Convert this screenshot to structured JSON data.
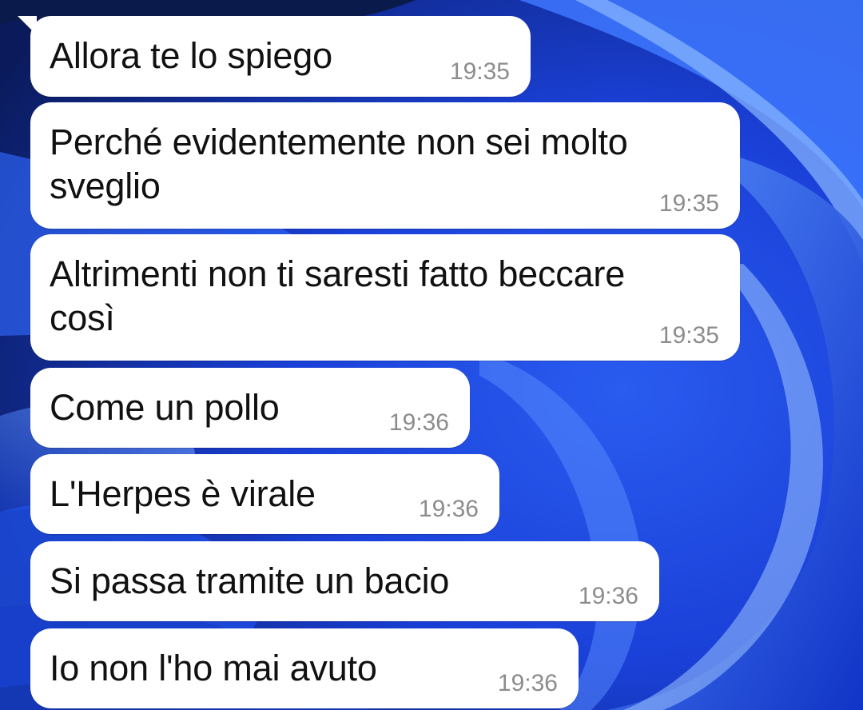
{
  "chat": {
    "messages": [
      {
        "text": "Allora te lo spiego",
        "time": "19:35"
      },
      {
        "text": "Perché evidentemente non sei molto\nsveglio",
        "time": "19:35"
      },
      {
        "text": "Altrimenti non ti saresti fatto beccare\ncosì",
        "time": "19:35"
      },
      {
        "text": "Come un pollo",
        "time": "19:36"
      },
      {
        "text": "L'Herpes è virale",
        "time": "19:36"
      },
      {
        "text": "Si passa tramite un bacio",
        "time": "19:36"
      },
      {
        "text": "Io non l'ho mai avuto",
        "time": "19:36"
      }
    ]
  },
  "colors": {
    "bubble": "#ffffff",
    "text": "#111111",
    "time": "#8c8c8c",
    "wallpaper_dark": "#0a1e6e",
    "wallpaper_bright": "#3d7bff"
  }
}
